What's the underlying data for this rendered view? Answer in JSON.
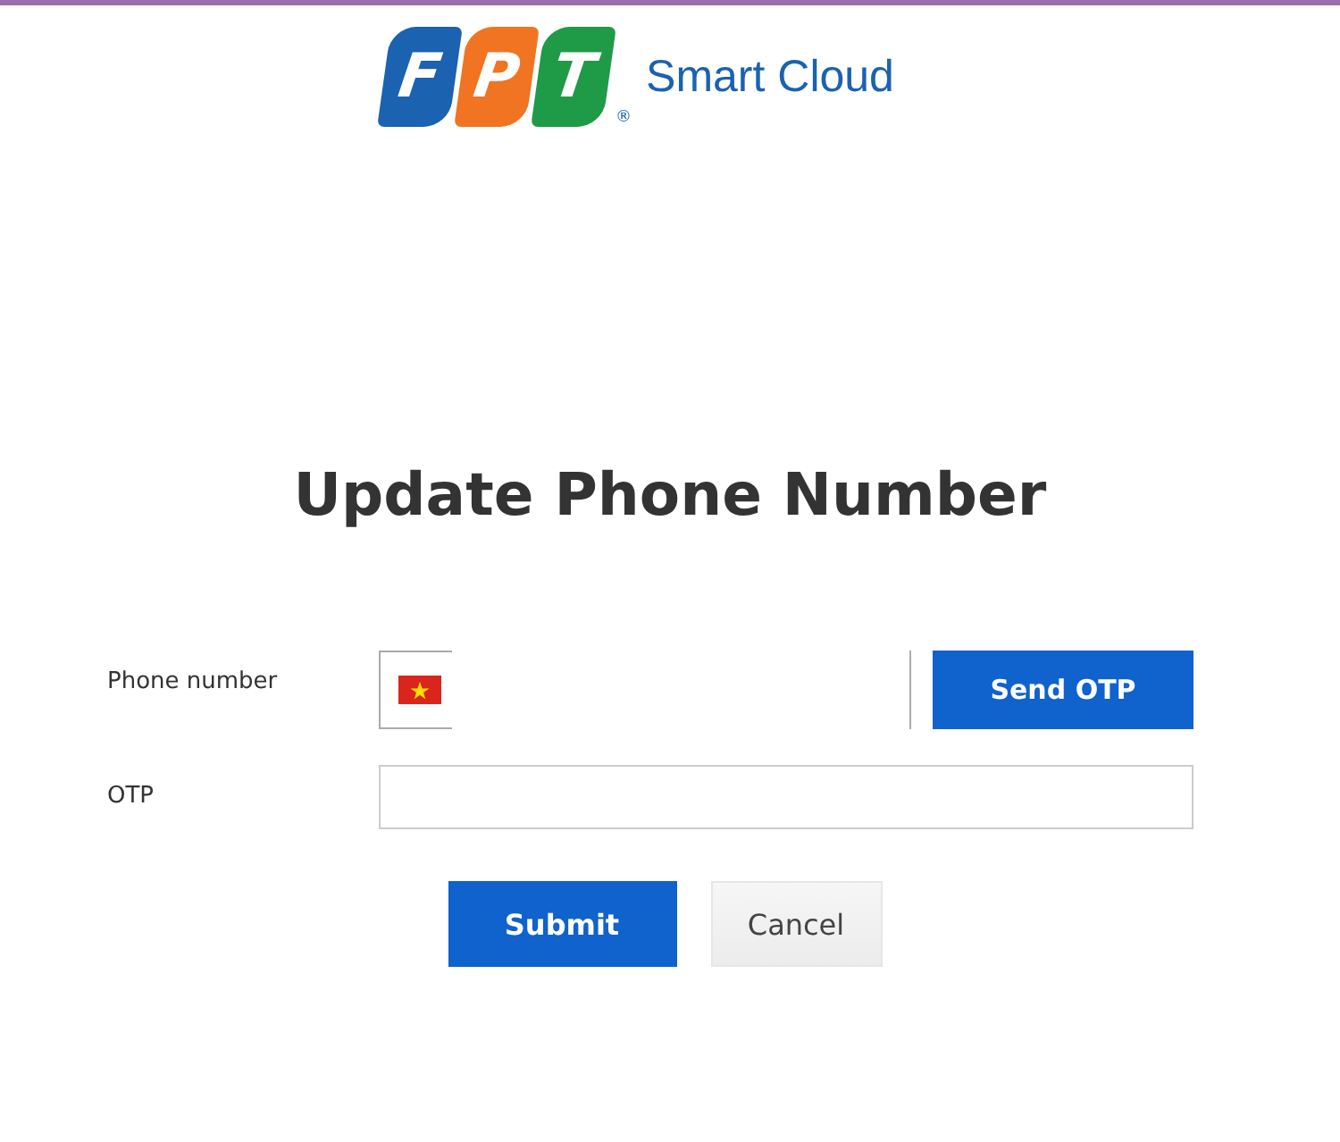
{
  "logo": {
    "letters": [
      "F",
      "P",
      "T"
    ],
    "registered": "®",
    "product": "Smart Cloud"
  },
  "title": "Update Phone Number",
  "fields": [
    {
      "kind": "phone",
      "label": "Phone number",
      "button": "Send OTP"
    },
    {
      "kind": "text",
      "label": "OTP"
    }
  ],
  "buttons": [
    {
      "label": "Submit",
      "kind": "primary"
    },
    {
      "label": "Cancel",
      "kind": "secondary"
    }
  ]
}
